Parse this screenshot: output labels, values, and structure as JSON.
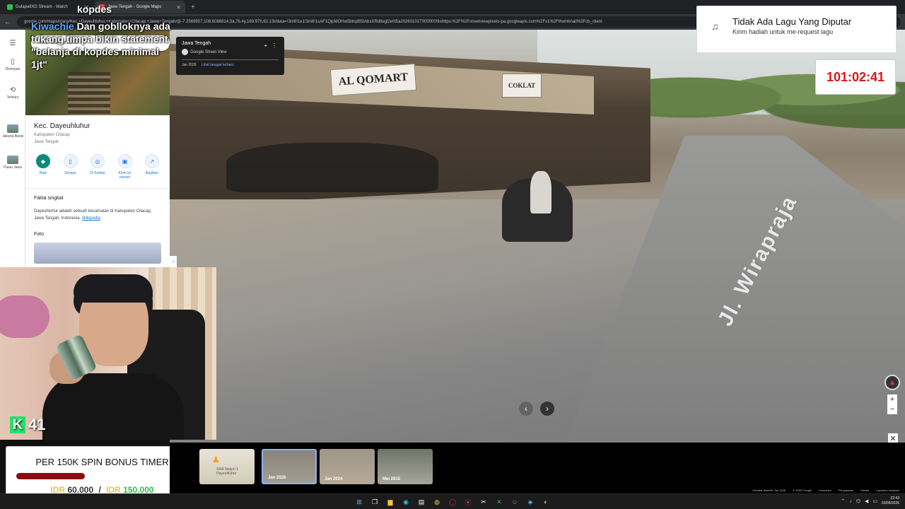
{
  "browser": {
    "tabs": [
      {
        "title": "GulapaitXD Stream - Watch",
        "color": "#2fbf4a"
      },
      {
        "title": "Jawa Tengah - Google Maps",
        "color": "#ea4335"
      }
    ],
    "url": "google.com/maps/place/Kec.+Dayeuhluhur,+Kabupaten+Cilacap,+Jawa+Tengah/@-7.2569957,108.6086814,3a,76.4y,169.97h,62.13t/data=!3m8!1e1!3m6!1sAF1QipMOHw5btnpB5tAbxXRd8egl2e0l5a20260101T000000!6shttps:%2F%2Fstreetviewpixels-pa.googleapis.com%2Fv1%2Fthumbnail%3Fcb_client"
  },
  "chat": {
    "top_text": "kopdes",
    "username": "Kiwachie",
    "message": "Dan goblloknya ada tukang timpa bikin statement \"belanja di kopdes minimal 1jt\""
  },
  "maps": {
    "search_value": "Kec. Dayeuhluhur",
    "rail": [
      {
        "icon": "menu-icon",
        "glyph": "☰",
        "label": ""
      },
      {
        "icon": "bookmark-icon",
        "glyph": "🔖",
        "label": "Disimpan"
      },
      {
        "icon": "history-icon",
        "glyph": "⟲",
        "label": "Terbaru"
      },
      {
        "icon": "place-thumb",
        "glyph": "",
        "label": "Jakarta Barat"
      },
      {
        "icon": "place-thumb",
        "glyph": "",
        "label": "Pulau Jawa"
      }
    ],
    "place_title": "Kec. Dayeuhluhur",
    "place_regency": "Kabupaten Cilacap",
    "place_province": "Jawa Tengah",
    "actions": [
      {
        "label": "Rute",
        "glyph": "◆"
      },
      {
        "label": "Simpan",
        "glyph": "▯"
      },
      {
        "label": "Di Sekitar",
        "glyph": "◎"
      },
      {
        "label": "Kirim ke ponsel",
        "glyph": "▣"
      },
      {
        "label": "Bagikan",
        "glyph": "↗"
      }
    ],
    "fakta_heading": "Fakta singkat",
    "fakta_text": "Dayeuhluhur adalah sebuah kecamatan di Kabupaten Cilacap, Jawa Tengah, Indonesia.",
    "fakta_link": "Wikipedia",
    "foto_heading": "Foto"
  },
  "street_view": {
    "region": "Jawa Tengah",
    "source": "Google Street View",
    "capture_date": "Jan 2026",
    "latest_link": "Lihat tanggal terbaru",
    "shop_sign_1": "AL QOMART",
    "shop_sign_2": "COKLAT",
    "road_label": "Jl. Wirapraja"
  },
  "timeline": {
    "thumbnails": [
      {
        "label": "",
        "caption": "SMA Negeri 1 Dayeuhluhur"
      },
      {
        "label": "Jan 2026",
        "selected": true
      },
      {
        "label": "Jan 2024"
      },
      {
        "label": "Mei 2015"
      }
    ],
    "credits": [
      "Gambar diambil: Jan 2026",
      "© 2026 Google",
      "Indonesia",
      "Persyaratan",
      "Privasi",
      "Laporkan masalah"
    ]
  },
  "music_widget": {
    "title": "Tidak Ada Lagu Yang Diputar",
    "subtitle": "Kirim hadiah untuk me-request lagu"
  },
  "timer": {
    "value": "101:02:41"
  },
  "spin_widget": {
    "title": "PER 150K SPIN BONUS TIMER",
    "currency_1": "IDR",
    "current": "60.000",
    "separator": "/",
    "currency_2": "IDR",
    "target": "150.000",
    "progress_fraction": 0.4
  },
  "webcam": {
    "badge_number": "41"
  },
  "taskbar": {
    "time": "22:43",
    "date": "03/08/2026"
  }
}
